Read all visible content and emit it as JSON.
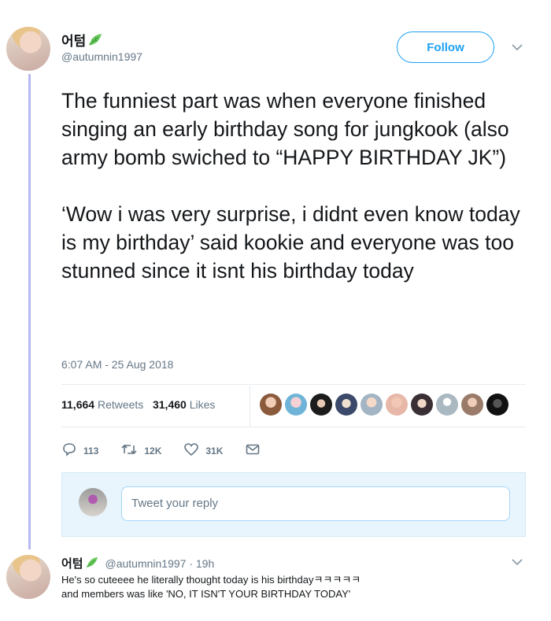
{
  "tweet": {
    "display_name": "어텀",
    "handle": "@autumnin1997",
    "follow_label": "Follow",
    "paragraphs": [
      "The funniest part was when everyone finished singing an early birthday song for jungkook (also army bomb swiched to “HAPPY BIRTHDAY JK”)",
      "‘Wow i was very surprise, i didnt even know today is my birthday’ said kookie and everyone was too stunned since it isnt his birthday today"
    ],
    "timestamp": "6:07 AM - 25 Aug 2018",
    "retweets_count": "11,664",
    "retweets_label": "Retweets",
    "likes_count": "31,460",
    "likes_label": "Likes",
    "actions": {
      "reply_count": "113",
      "retweet_count": "12K",
      "like_count": "31K"
    }
  },
  "reply_composer": {
    "placeholder": "Tweet your reply"
  },
  "reply": {
    "display_name": "어텀",
    "meta": "@autumnin1997 · 19h",
    "lines": [
      "He's so cuteeee he literally thought today is his birthdayㅋㅋㅋㅋㅋ",
      "and members was like 'NO, IT ISN'T YOUR BIRTHDAY TODAY'"
    ]
  },
  "colors": {
    "accent": "#1da1f2",
    "thread_line": "#b6b8f0",
    "muted": "#657786",
    "leaf_icon": "#6ccb5f"
  },
  "icons": [
    "leaf-icon",
    "chevron-down-icon",
    "reply-icon",
    "retweet-icon",
    "heart-icon",
    "message-icon"
  ]
}
